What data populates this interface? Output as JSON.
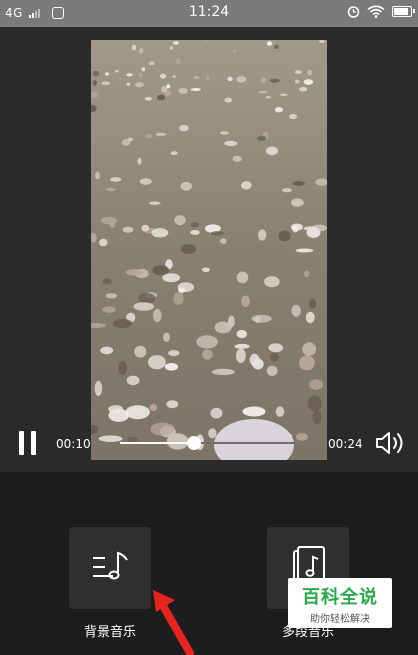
{
  "status_bar": {
    "network": "4G",
    "time": "11:24"
  },
  "player": {
    "current_time": "00:10",
    "total_time": "00:24",
    "progress": 0.42
  },
  "tools": [
    {
      "label": "背景音乐",
      "icon": "music-note-icon"
    },
    {
      "label": "多段音乐",
      "icon": "music-file-icon"
    }
  ],
  "watermark": {
    "title": "百科全说",
    "subtitle": "助你轻松解决"
  },
  "colors": {
    "accent_green": "#2aa84a",
    "arrow_red": "#e52420"
  }
}
